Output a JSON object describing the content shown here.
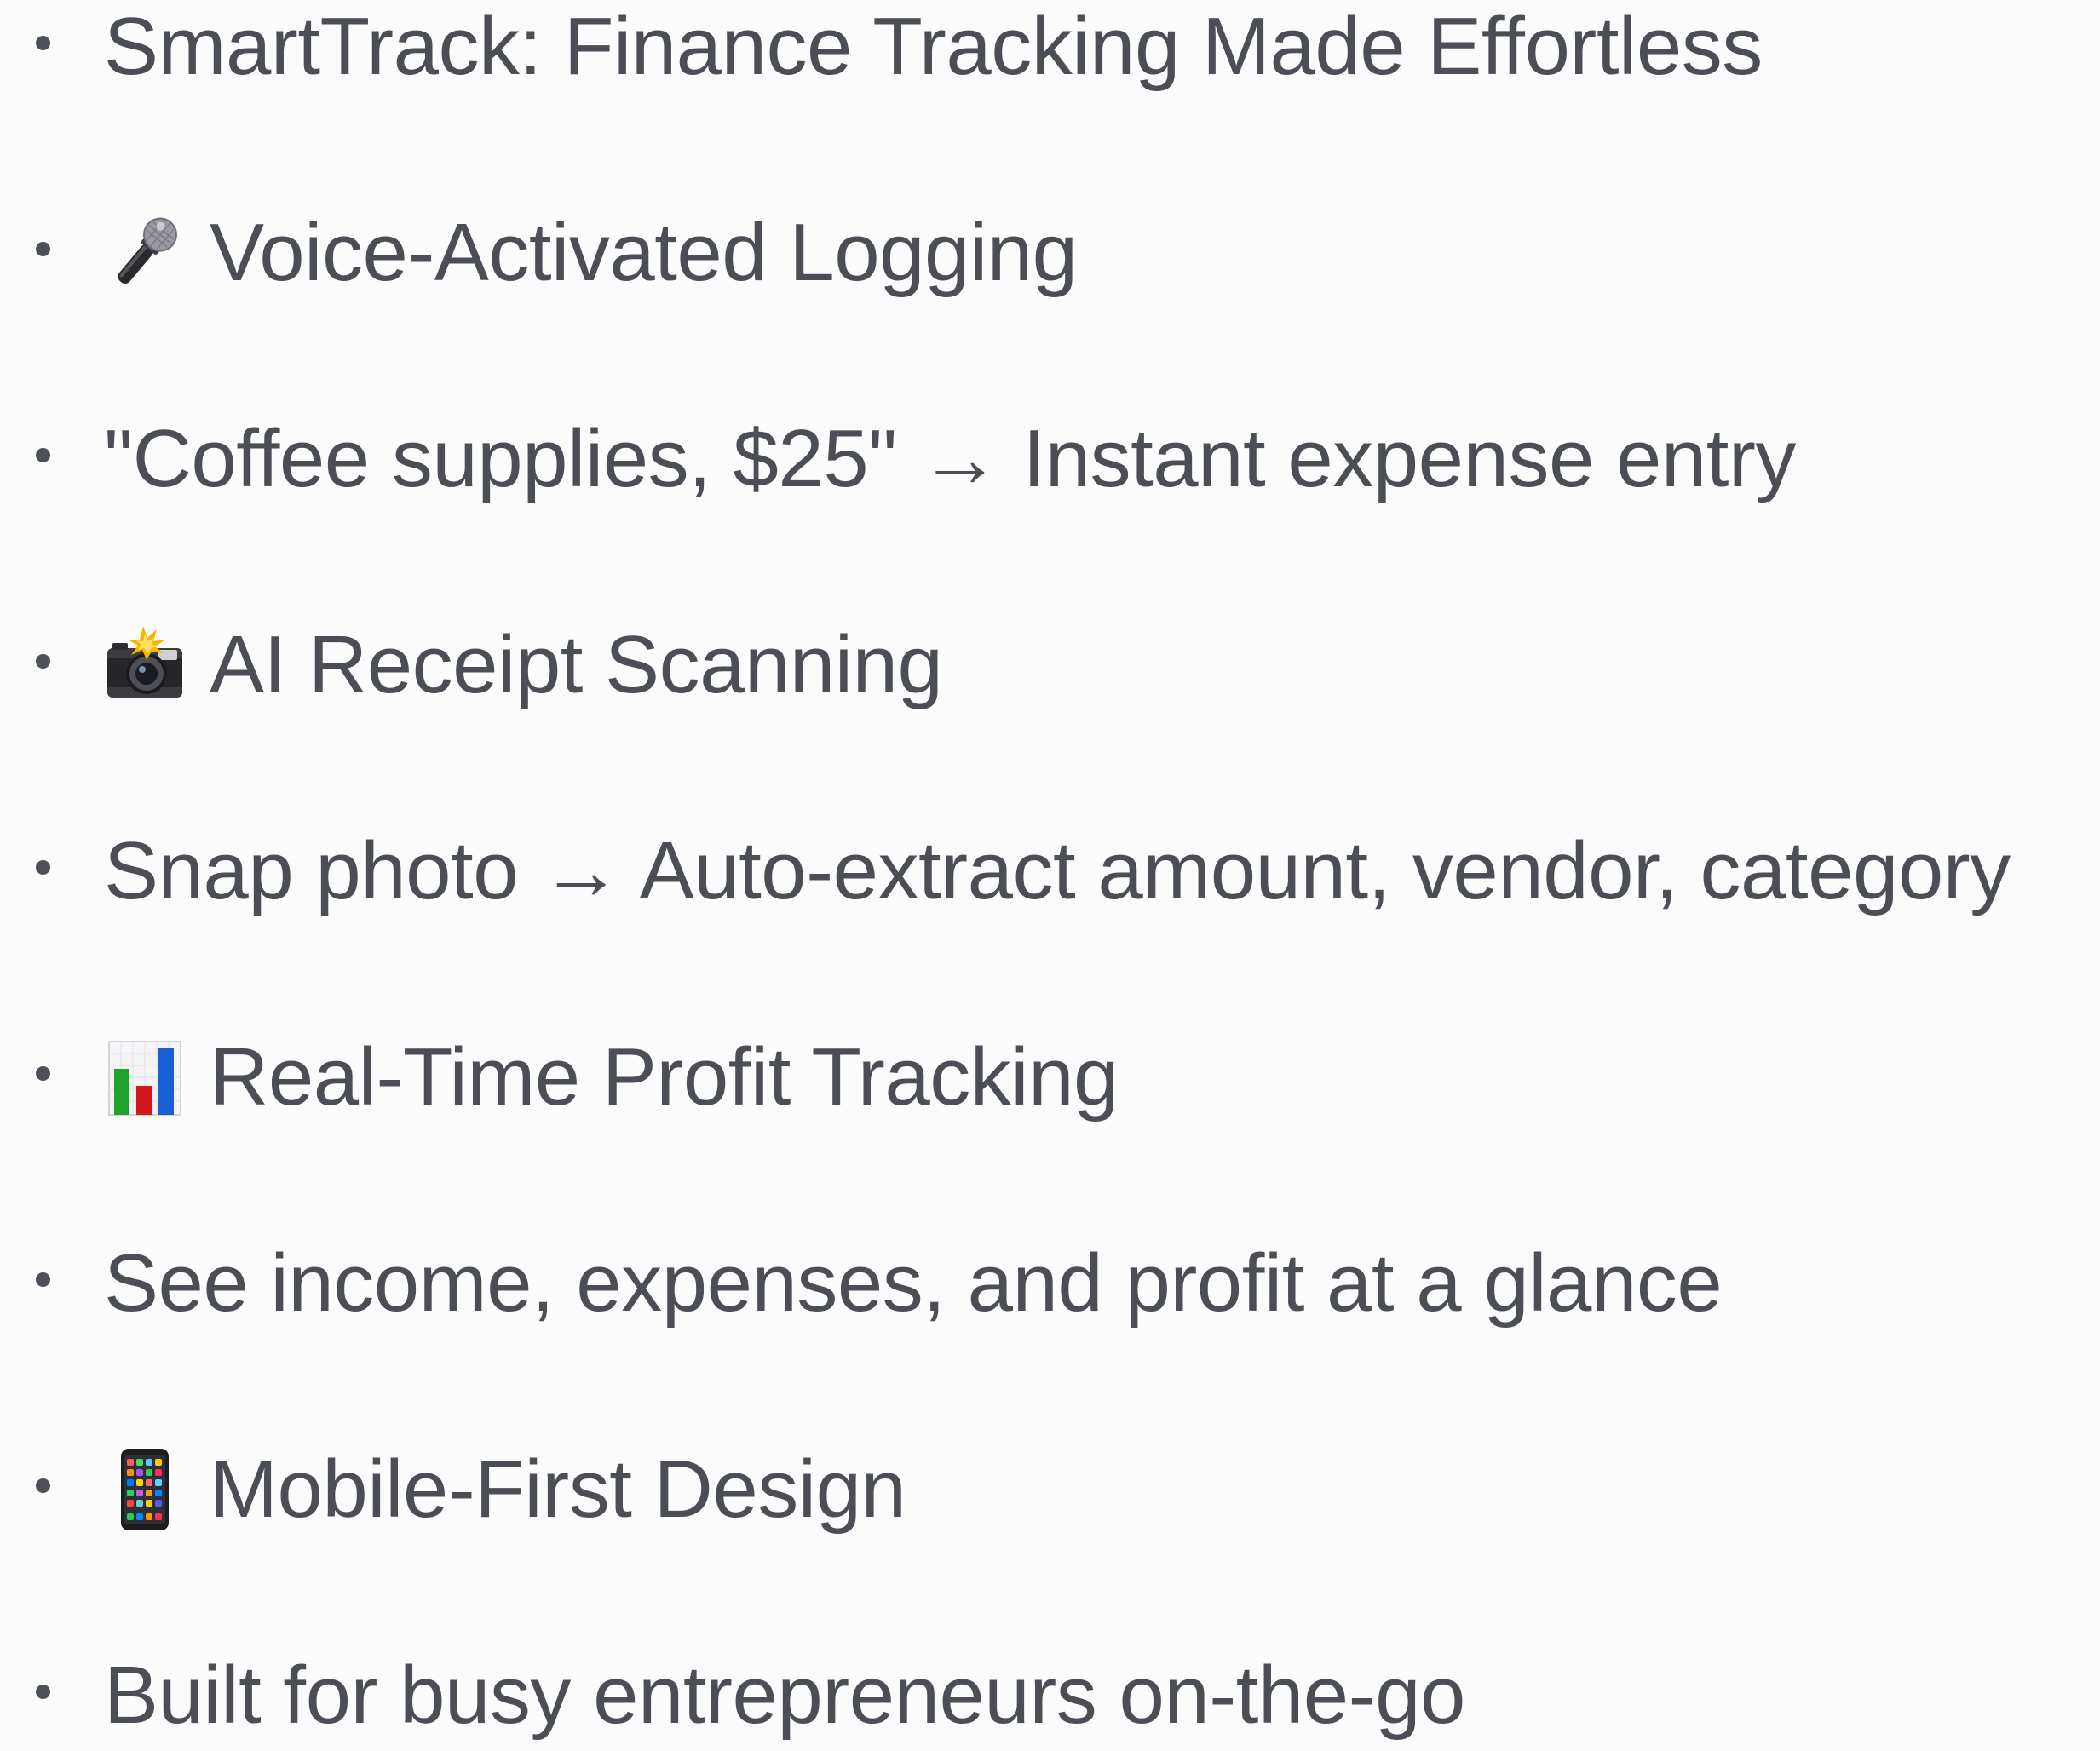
{
  "items": [
    {
      "text": "SmartTrack: Finance Tracking Made Effortless",
      "icon": null
    },
    {
      "text": "Voice-Activated Logging",
      "icon": "microphone-icon"
    },
    {
      "text": "\"Coffee supplies, $25\" → Instant expense entry",
      "icon": null
    },
    {
      "text": "AI Receipt Scanning",
      "icon": "camera-flash-icon"
    },
    {
      "text": "Snap photo → Auto-extract amount, vendor, category",
      "icon": null
    },
    {
      "text": "Real-Time Profit Tracking",
      "icon": "bar-chart-icon"
    },
    {
      "text": "See income, expenses, and profit at a glance",
      "icon": null
    },
    {
      "text": "Mobile-First Design",
      "icon": "mobile-phone-icon"
    },
    {
      "text": "Built for busy entrepreneurs on-the-go",
      "icon": null
    }
  ]
}
